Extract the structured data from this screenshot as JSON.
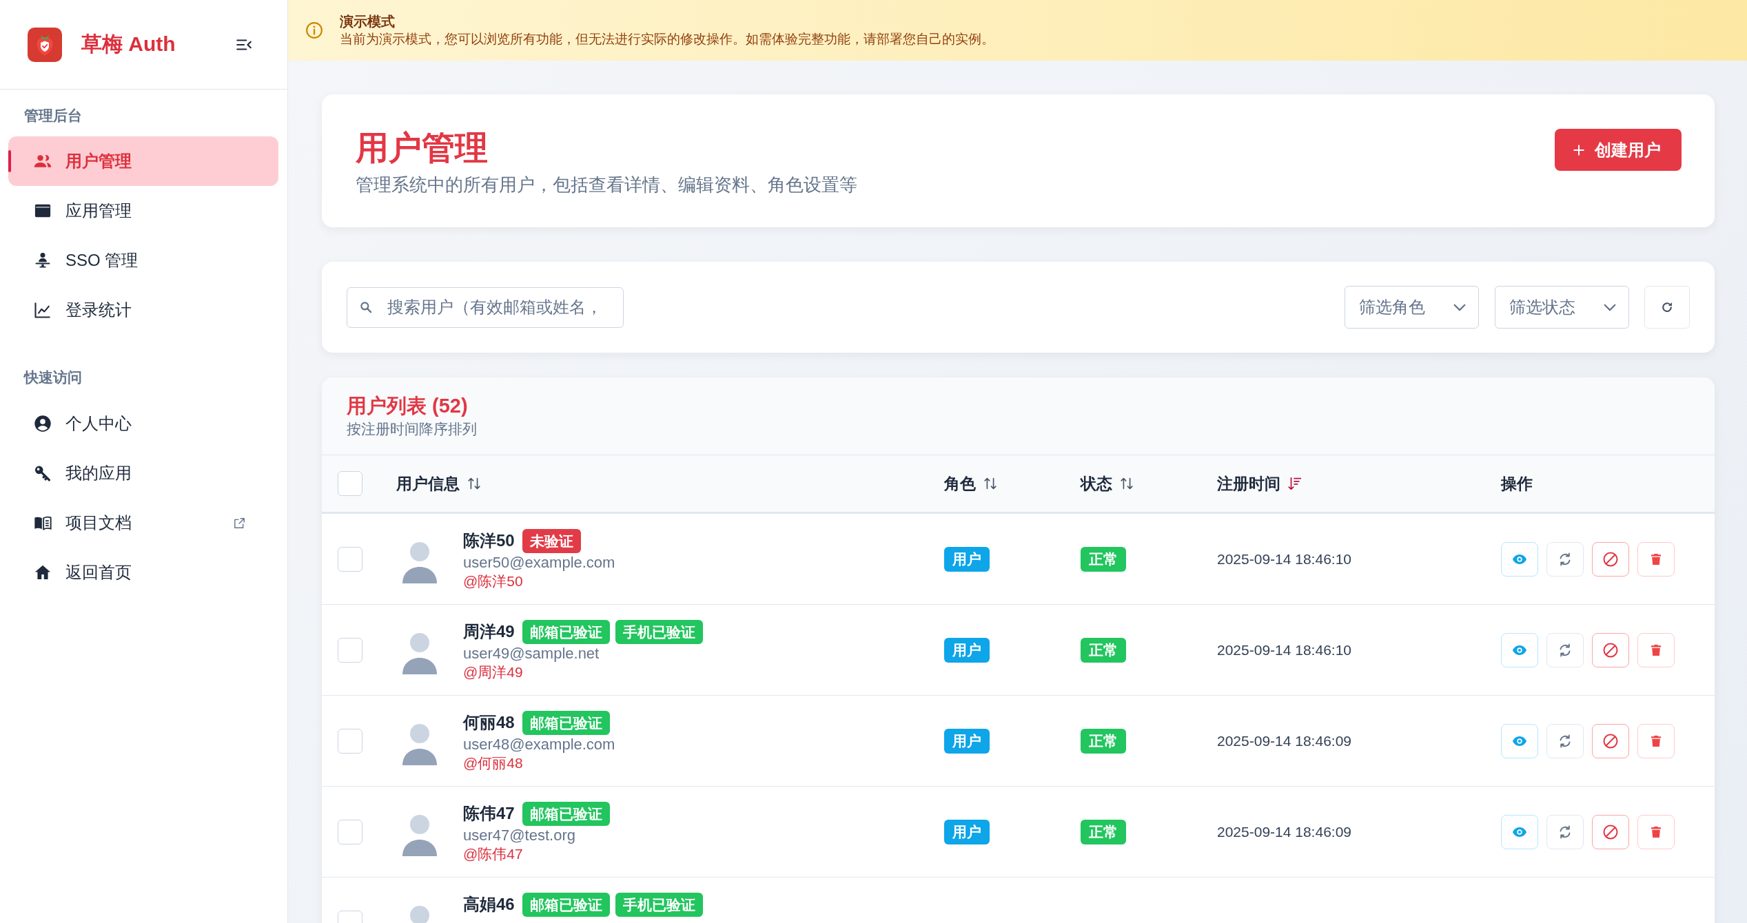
{
  "sidebar": {
    "brand": "草梅 Auth",
    "sections": [
      {
        "title": "管理后台",
        "items": [
          {
            "label": "用户管理",
            "selected": true,
            "external": false
          },
          {
            "label": "应用管理",
            "selected": false,
            "external": false
          },
          {
            "label": "SSO 管理",
            "selected": false,
            "external": false
          },
          {
            "label": "登录统计",
            "selected": false,
            "external": false
          }
        ]
      },
      {
        "title": "快速访问",
        "items": [
          {
            "label": "个人中心",
            "selected": false,
            "external": false
          },
          {
            "label": "我的应用",
            "selected": false,
            "external": false
          },
          {
            "label": "项目文档",
            "selected": false,
            "external": true
          },
          {
            "label": "返回首页",
            "selected": false,
            "external": false
          }
        ]
      }
    ]
  },
  "banner": {
    "title": "演示模式",
    "message": "当前为演示模式，您可以浏览所有功能，但无法进行实际的修改操作。如需体验完整功能，请部署您自己的实例。"
  },
  "header": {
    "title": "用户管理",
    "subtitle": "管理系统中的所有用户，包括查看详情、编辑资料、角色设置等",
    "create_button": "创建用户"
  },
  "filters": {
    "search": {
      "placeholder": "搜索用户（有效邮箱或姓名，"
    },
    "role_select": {
      "placeholder": "筛选角色"
    },
    "status_select": {
      "placeholder": "筛选状态"
    }
  },
  "table": {
    "title": "用户列表 (52)",
    "subtitle": "按注册时间降序排列",
    "select_all": {
      "checked": false
    },
    "columns": [
      {
        "label": "用户信息",
        "sortable": true,
        "sorted": false
      },
      {
        "label": "角色",
        "sortable": true,
        "sorted": false
      },
      {
        "label": "状态",
        "sortable": true,
        "sorted": false
      },
      {
        "label": "注册时间",
        "sortable": true,
        "sorted": true
      },
      {
        "label": "操作"
      }
    ],
    "rows": [
      {
        "checked": false,
        "name": "陈洋50",
        "badges": [
          {
            "label": "未验证",
            "color": "#e23b48"
          }
        ],
        "email": "user50@example.com",
        "handle": "@陈洋50",
        "role": "用户",
        "status": "正常",
        "registered": "2025-09-14 18:46:10"
      },
      {
        "checked": false,
        "name": "周洋49",
        "badges": [
          {
            "label": "邮箱已验证",
            "color": "#22c55e"
          },
          {
            "label": "手机已验证",
            "color": "#22c55e"
          }
        ],
        "email": "user49@sample.net",
        "handle": "@周洋49",
        "role": "用户",
        "status": "正常",
        "registered": "2025-09-14 18:46:10"
      },
      {
        "checked": false,
        "name": "何丽48",
        "badges": [
          {
            "label": "邮箱已验证",
            "color": "#22c55e"
          }
        ],
        "email": "user48@example.com",
        "handle": "@何丽48",
        "role": "用户",
        "status": "正常",
        "registered": "2025-09-14 18:46:09"
      },
      {
        "checked": false,
        "name": "陈伟47",
        "badges": [
          {
            "label": "邮箱已验证",
            "color": "#22c55e"
          }
        ],
        "email": "user47@test.org",
        "handle": "@陈伟47",
        "role": "用户",
        "status": "正常",
        "registered": "2025-09-14 18:46:09"
      },
      {
        "checked": false,
        "name": "高娟46",
        "badges": [
          {
            "label": "邮箱已验证",
            "color": "#22c55e"
          },
          {
            "label": "手机已验证",
            "color": "#22c55e"
          }
        ]
      }
    ]
  }
}
